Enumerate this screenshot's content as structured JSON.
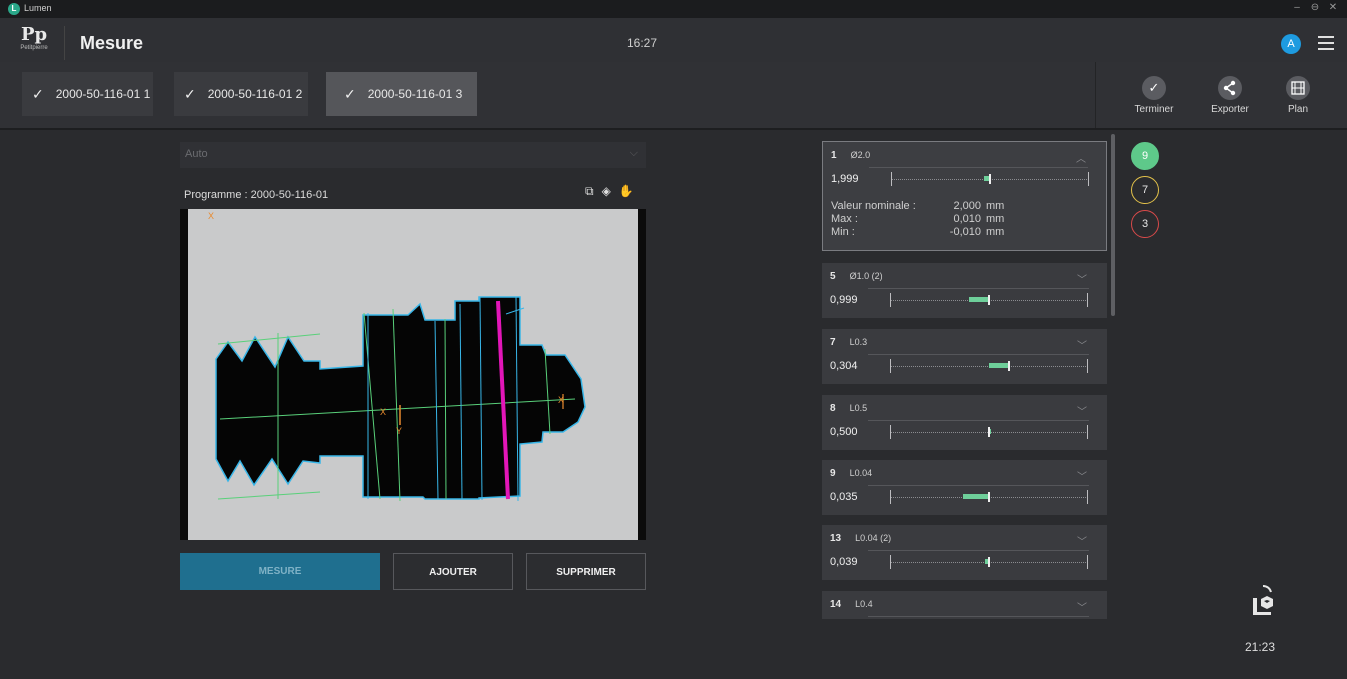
{
  "app": {
    "name": "Lumen",
    "logo_letter": "L"
  },
  "window_controls": {
    "minimize": "–",
    "restore": "⊖",
    "close": "✕"
  },
  "header": {
    "logo_text": "Pp",
    "logo_sub": "Petitpierre",
    "title": "Mesure",
    "clock": "16:27",
    "avatar": "A"
  },
  "tabs": [
    {
      "label": "2000-50-116-01 1",
      "check": "✓",
      "active": false
    },
    {
      "label": "2000-50-116-01 2",
      "check": "✓",
      "active": false
    },
    {
      "label": "2000-50-116-01 3",
      "check": "✓",
      "active": true
    }
  ],
  "actions": [
    {
      "label": "Terminer",
      "icon": "check-icon",
      "glyph": "✓"
    },
    {
      "label": "Exporter",
      "icon": "share-icon",
      "glyph": "⋖"
    },
    {
      "label": "Plan",
      "icon": "plan-icon",
      "glyph": "▤"
    }
  ],
  "left": {
    "mode_select": "Auto",
    "program_label": "Programme : 2000-50-116-01",
    "overlay_labels": {
      "x1": "X",
      "x2": "X",
      "x3": "X",
      "y": "Y"
    },
    "buttons": {
      "mesure": "MESURE",
      "ajouter": "AJOUTER",
      "supprimer": "SUPPRIMER"
    }
  },
  "measurements": [
    {
      "num": "1",
      "label": "Ø2.0",
      "value": "1,999",
      "open": true,
      "fill": {
        "from": 0.47,
        "to": 0.5
      }
    },
    {
      "num": "5",
      "label": "Ø1.0 (2)",
      "value": "0,999",
      "open": false,
      "fill": {
        "from": 0.4,
        "to": 0.5
      }
    },
    {
      "num": "7",
      "label": "L0.3",
      "value": "0,304",
      "open": false,
      "fill": {
        "from": 0.5,
        "to": 0.6
      }
    },
    {
      "num": "8",
      "label": "L0.5",
      "value": "0,500",
      "open": false,
      "fill": {
        "from": 0.5,
        "to": 0.5
      }
    },
    {
      "num": "9",
      "label": "L0.04",
      "value": "0,035",
      "open": false,
      "fill": {
        "from": 0.37,
        "to": 0.5
      }
    },
    {
      "num": "13",
      "label": "L0.04 (2)",
      "value": "0,039",
      "open": false,
      "fill": {
        "from": 0.48,
        "to": 0.5
      }
    },
    {
      "num": "14",
      "label": "L0.4",
      "value": "",
      "open": false,
      "fill": null
    }
  ],
  "details": {
    "rows": [
      {
        "k": "Valeur nominale :",
        "v": "2,000",
        "u": "mm"
      },
      {
        "k": "Max :",
        "v": "0,010",
        "u": "mm"
      },
      {
        "k": "Min :",
        "v": "-0,010",
        "u": "mm"
      }
    ]
  },
  "status_counts": {
    "ok": "9",
    "warning": "7",
    "error": "3"
  },
  "colors": {
    "ok": "#5ec98a",
    "warning": "#e2c14a",
    "error": "#d84a4a",
    "accent": "#1f6f8f"
  },
  "footer_time": "21:23"
}
